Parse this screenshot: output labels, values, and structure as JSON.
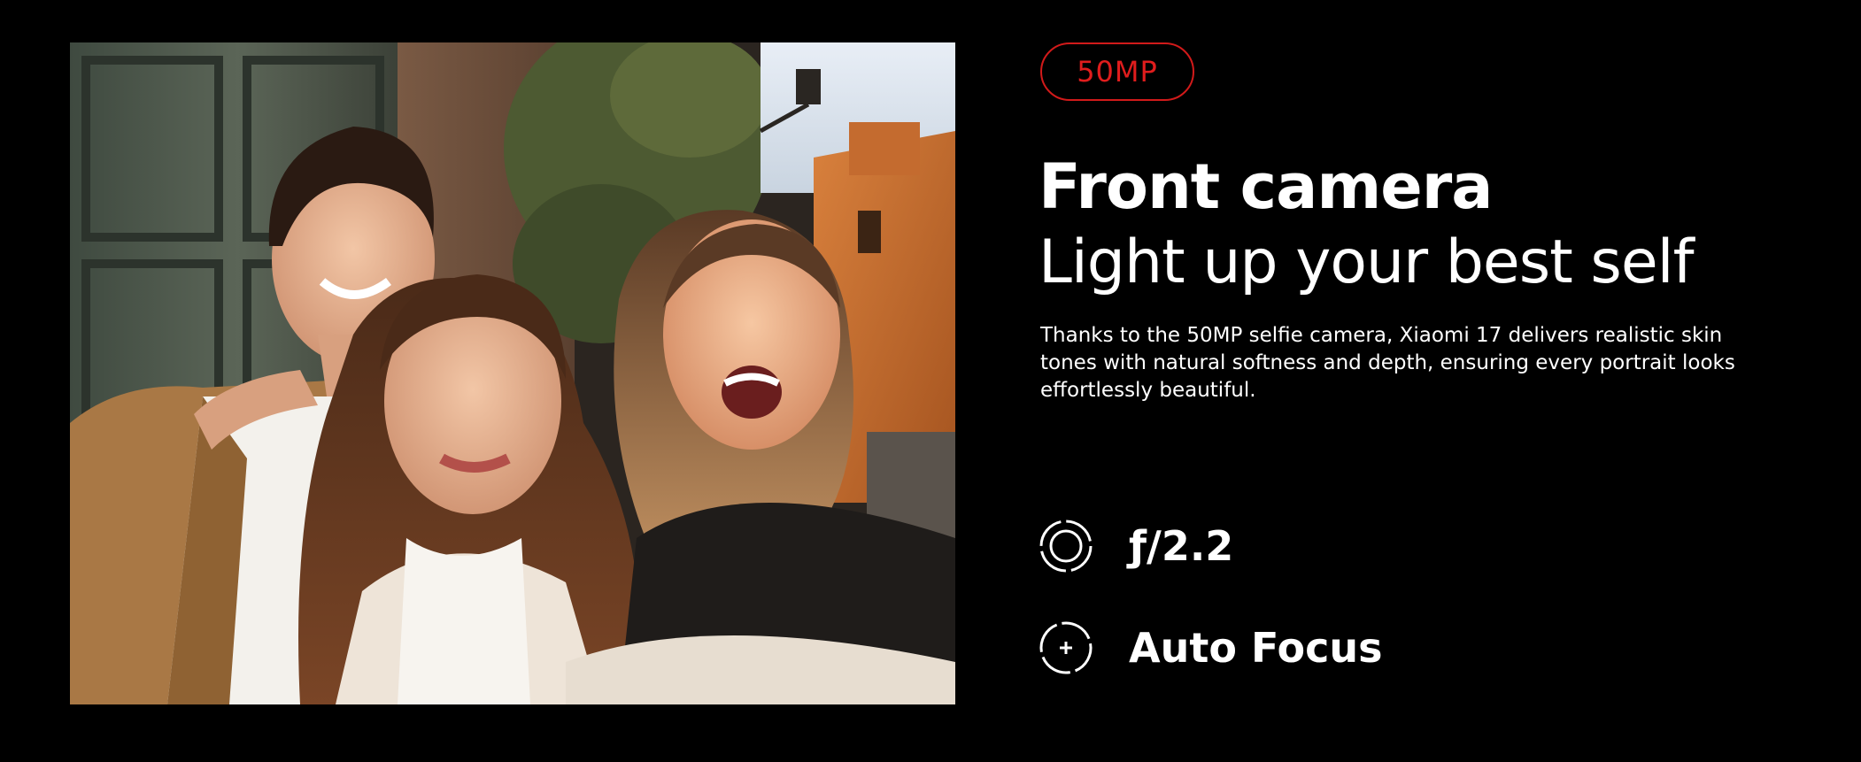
{
  "photo": {
    "icon": "selfie-photo"
  },
  "badge": {
    "label": "50MP",
    "color": "#e01d1d"
  },
  "heading": {
    "title": "Front camera",
    "subtitle": "Light up your best self"
  },
  "description": "Thanks to the 50MP selfie camera, Xiaomi 17 delivers realistic skin tones with natural softness and depth, ensuring every portrait looks effortlessly beautiful.",
  "specs": [
    {
      "icon": "aperture-icon",
      "label": "ƒ/2.2"
    },
    {
      "icon": "focus-icon",
      "label": "Auto Focus"
    }
  ],
  "colors": {
    "background": "#000000",
    "text": "#ffffff",
    "accent": "#e01d1d"
  }
}
